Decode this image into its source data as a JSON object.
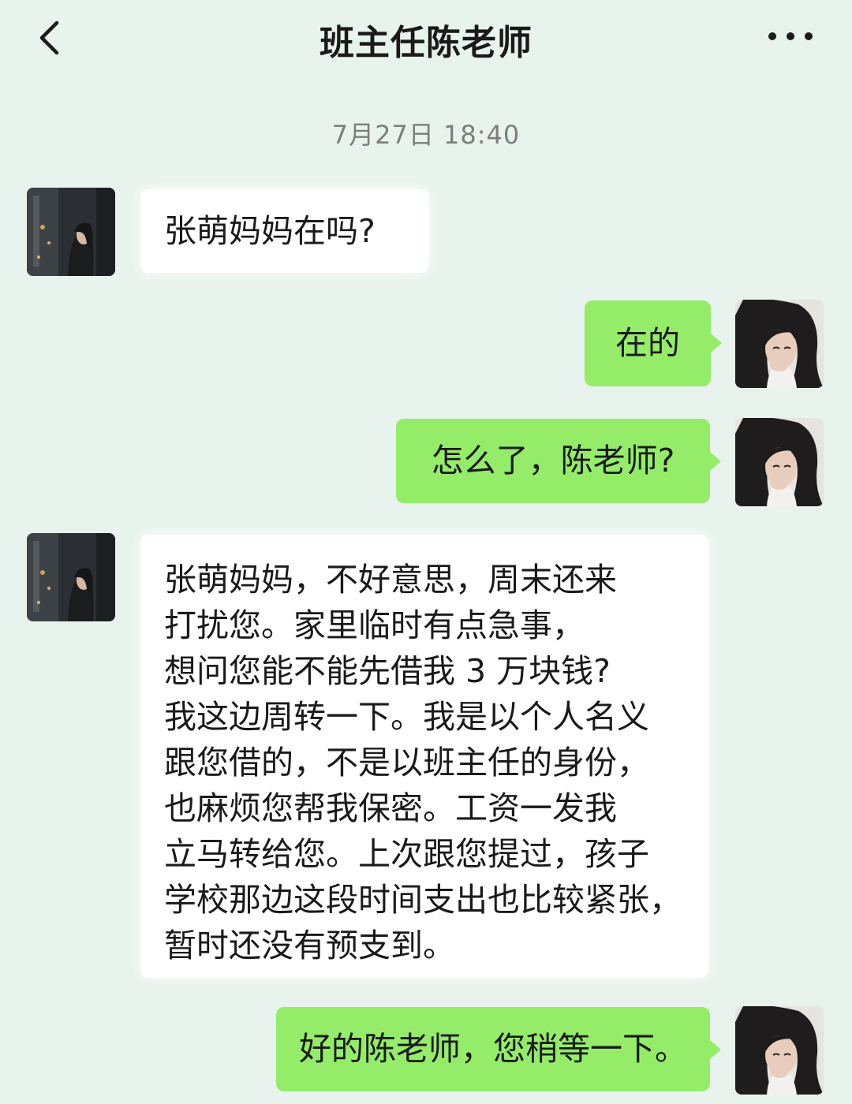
{
  "header": {
    "title": "班主任陈老师",
    "back_icon": "chevron-left-icon",
    "more_icon": "more-dots-icon"
  },
  "timestamp": "7月27日  18:40",
  "messages": [
    {
      "sender": "teacher",
      "text": "张萌妈妈在吗?"
    },
    {
      "sender": "me",
      "text": "在的"
    },
    {
      "sender": "me",
      "text": "怎么了，陈老师?"
    },
    {
      "sender": "teacher",
      "lines": [
        "张萌妈妈，不好意思，周末还来",
        "打扰您。家里临时有点急事，",
        "想问您能不能先借我 3 万块钱?",
        "我这边周转一下。我是以个人名义",
        "跟您借的，不是以班主任的身份，",
        "也麻烦您帮我保密。工资一发我",
        "立马转给您。上次跟您提过，孩子",
        "学校那边这段时间支出也比较紧张，",
        "暂时还没有预支到。"
      ]
    },
    {
      "sender": "me",
      "text": "好的陈老师，您稍等一下。"
    }
  ],
  "colors": {
    "background": "#e9f3ee",
    "outgoing_bubble": "#95ec69",
    "incoming_bubble": "#ffffff",
    "text": "#1a1a1a",
    "timestamp": "#7d7d7d"
  }
}
